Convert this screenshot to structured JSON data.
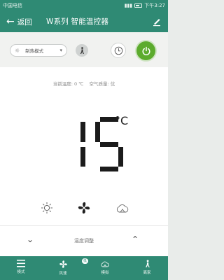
{
  "status": {
    "carrier": "中国电信",
    "time": "下午3:27"
  },
  "header": {
    "back_label": "返回",
    "title": "W系列 智能温控器"
  },
  "controls": {
    "mode_value": "制热模式"
  },
  "info": {
    "current_temp": "当前温度: 0 ℃",
    "air_quality": "空气质量: 优"
  },
  "display": {
    "temperature": "15",
    "unit": "°C"
  },
  "adjust": {
    "label": "温度调整"
  },
  "nav": {
    "items": [
      {
        "label": "模式",
        "icon": "menu-icon"
      },
      {
        "label": "风速",
        "icon": "fan-icon",
        "badge": "低"
      },
      {
        "label": "模拟",
        "icon": "cloud-icon"
      },
      {
        "label": "离家",
        "icon": "walking-person-icon"
      }
    ]
  },
  "colors": {
    "primary": "#2f8a74",
    "power": "#5cab2d",
    "digit": "#1b1b1b"
  }
}
